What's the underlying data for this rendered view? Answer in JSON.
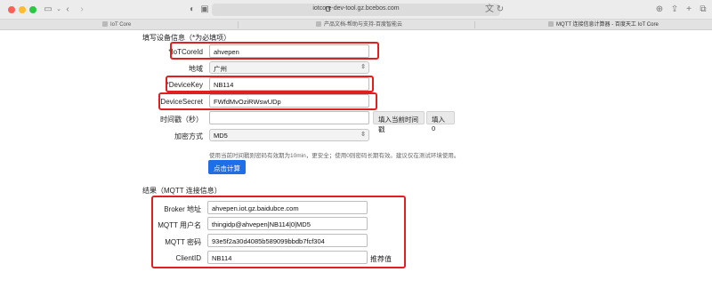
{
  "browser": {
    "url": "iotcore-dev-tool.gz.bcebos.com",
    "tabs": [
      "IoT Core",
      "产品文档-帮助与支持-百度智能云",
      "MQTT 连接信息计算器 - 百度天工 IoT Core"
    ]
  },
  "colors": {
    "primary_button": "#1e6ee8",
    "highlight_border": "#e02020"
  },
  "form": {
    "section_title": "填写设备信息（*为必填项）",
    "iotcoreid": {
      "label": "*IoTCoreId",
      "value": "ahvepen"
    },
    "region": {
      "label": "地域",
      "value": "广州"
    },
    "devicekey": {
      "label": "*DeviceKey",
      "value": "NB114"
    },
    "devicesecret": {
      "label": "*DeviceSecret",
      "value": "FWfdMvOziRWswUDp"
    },
    "timestamp": {
      "label": "时间戳（秒）",
      "value": "",
      "fill_current_button": "填入当前时间戳",
      "fill_zero_button": "填入 0"
    },
    "encryption": {
      "label": "加密方式",
      "value": "MD5"
    },
    "hint": "使用当前时间戳则密码有效期为10min，更安全；使用0则密码长期有效。建议仅在测试环境使用。",
    "calculate_button": "点击计算"
  },
  "result": {
    "section_title": "结果（MQTT 连接信息）",
    "broker": {
      "label": "Broker 地址",
      "value": "ahvepen.iot.gz.baidubce.com"
    },
    "username": {
      "label": "MQTT 用户名",
      "value": "thingidp@ahvepen|NB114|0|MD5"
    },
    "password": {
      "label": "MQTT 密码",
      "value": "93e5f2a30d4085b589099bbdb7fcf304"
    },
    "clientid": {
      "label": "ClientID",
      "value": "NB114",
      "recommended": "推荐值"
    }
  }
}
